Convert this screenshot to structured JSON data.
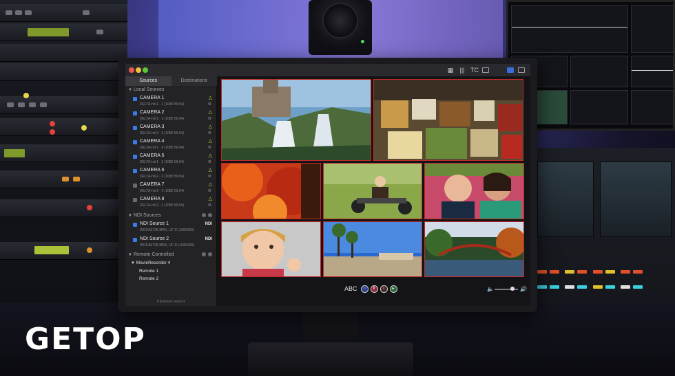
{
  "brand": {
    "logo": "GETOP"
  },
  "app": {
    "tabs": [
      {
        "label": "Sources",
        "active": true
      },
      {
        "label": "Destinations",
        "active": false
      }
    ],
    "toolbar": {
      "tc_label": "TC",
      "accent": "#3a6edb"
    },
    "local_sources": {
      "header": "Local Sources",
      "items": [
        {
          "name": "CAMERA 1",
          "detail": "DELTA-hd-1 - 1 (1080 59.94)",
          "enabled": true
        },
        {
          "name": "CAMERA 2",
          "detail": "DELTA-hd-1 - 2 (1080 59.94)",
          "enabled": true
        },
        {
          "name": "CAMERA 3",
          "detail": "DELTA-hd-3 - 3 (1080 59.94)",
          "enabled": true
        },
        {
          "name": "CAMERA 4",
          "detail": "DELTA-hd-1 - 4 (1080 59.94)",
          "enabled": true
        },
        {
          "name": "CAMERA 5",
          "detail": "DELTA-hd-1 - 5 (1080 59.94)",
          "enabled": true
        },
        {
          "name": "CAMERA 6",
          "detail": "DELTA-hd-2 - 2 (1080 59.94)",
          "enabled": true
        },
        {
          "name": "CAMERA 7",
          "detail": "DELTA-hd-2 - 2 (1080 59.94)",
          "enabled": false
        },
        {
          "name": "CAMERA 8",
          "detail": "DELTA-hd-2 - 2 (1080 59.94)",
          "enabled": false
        }
      ]
    },
    "ndi_sources": {
      "header": "NDI Sources",
      "items": [
        {
          "name": "NDI Source 1",
          "detail": "WOCA0735-MRK, UF 1I (1080100)",
          "badge": "NDI"
        },
        {
          "name": "NDI Source 2",
          "detail": "WOCA0735-MRK, UF 1I (1080100)",
          "badge": "NDI"
        }
      ]
    },
    "remote": {
      "header": "Remote Controlled",
      "recorder": "MovieRecorder 4",
      "children": [
        "Remote 1",
        "Remote 2"
      ]
    },
    "footer": "8 licensed sources",
    "transport": {
      "label": "ABC"
    },
    "tile_border_color": "#c22a2a"
  }
}
